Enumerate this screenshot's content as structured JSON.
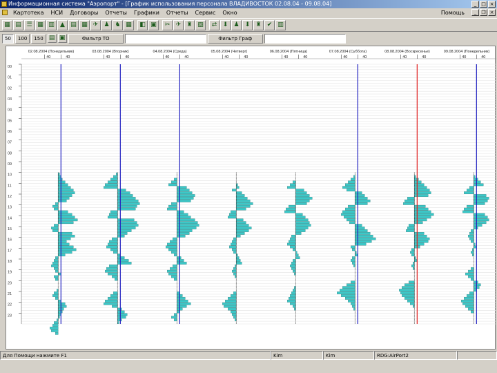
{
  "window": {
    "title": "Информационная система \"Аэропорт\" - [График использования персонала ВЛАДИВОСТОК 02.08.04 - 09.08.04]"
  },
  "menu": [
    "Картотека",
    "НСИ",
    "Договоры",
    "Отчеты",
    "Графики",
    "Отчеты",
    "Сервис",
    "Окно"
  ],
  "menu_right": "Помощь",
  "toolbar2": {
    "scale_buttons": [
      "50",
      "100",
      "150"
    ],
    "filter_to_label": "Фильтр ТО",
    "filter_graf_label": "Фильтр Граф"
  },
  "chart_data": {
    "type": "bar",
    "orientation": "horizontal-per-day",
    "days": [
      {
        "label": "02.08.2004 (Понедельник)",
        "ticks": [
          "40",
          "40"
        ],
        "line_color": "#2020c0",
        "values": [
          0,
          0,
          0,
          0,
          0,
          0,
          0,
          0,
          0,
          0,
          0,
          0,
          0,
          0,
          0,
          0,
          0,
          0,
          0,
          0,
          0,
          0,
          0,
          0,
          0,
          0,
          0,
          0,
          0,
          0,
          0,
          0,
          0,
          0,
          0,
          0,
          0,
          0,
          0,
          0,
          2,
          4,
          6,
          10,
          14,
          18,
          22,
          24,
          20,
          16,
          12,
          -4,
          -8,
          -6,
          14,
          20,
          24,
          28,
          22,
          -6,
          -10,
          -8,
          20,
          24,
          18,
          12,
          16,
          22,
          26,
          20,
          10,
          -4,
          -6,
          -8,
          -10,
          -6,
          -4,
          4,
          -6,
          -4,
          0,
          0,
          0,
          -2,
          -6,
          -8,
          -4,
          4,
          10,
          12,
          8,
          6,
          4,
          2,
          -2,
          -6,
          -8,
          -12,
          -10,
          -4
        ]
      },
      {
        "label": "03.08.2004 (Вторник)",
        "ticks": [
          "40",
          "40"
        ],
        "line_color": "#2020c0",
        "values": [
          0,
          0,
          0,
          0,
          0,
          0,
          0,
          0,
          0,
          0,
          0,
          0,
          0,
          0,
          0,
          0,
          0,
          0,
          0,
          0,
          0,
          0,
          0,
          0,
          0,
          0,
          0,
          0,
          0,
          0,
          0,
          0,
          0,
          0,
          0,
          0,
          0,
          0,
          0,
          0,
          -2,
          -6,
          -10,
          -14,
          -18,
          -20,
          12,
          18,
          22,
          26,
          30,
          32,
          28,
          26,
          -10,
          -12,
          -14,
          24,
          28,
          30,
          26,
          20,
          14,
          10,
          -8,
          -12,
          -14,
          -16,
          -10,
          -6,
          4,
          10,
          16,
          20,
          -12,
          -16,
          -18,
          -14,
          -8,
          -4,
          0,
          0,
          0,
          0,
          -6,
          -10,
          -14,
          -18,
          -20,
          -8,
          6,
          10,
          14,
          12,
          6,
          2,
          0,
          0,
          0,
          0
        ]
      },
      {
        "label": "04.08.2004 (Среда)",
        "ticks": [
          "40",
          "40"
        ],
        "line_color": "#2020c0",
        "values": [
          0,
          0,
          0,
          0,
          0,
          0,
          0,
          0,
          0,
          0,
          0,
          0,
          0,
          0,
          0,
          0,
          0,
          0,
          0,
          0,
          0,
          0,
          0,
          0,
          0,
          0,
          0,
          0,
          0,
          0,
          0,
          0,
          0,
          0,
          0,
          0,
          0,
          0,
          0,
          0,
          0,
          0,
          -4,
          -8,
          -12,
          14,
          18,
          22,
          26,
          24,
          20,
          -8,
          -12,
          -14,
          10,
          16,
          20,
          26,
          30,
          32,
          28,
          22,
          18,
          12,
          -6,
          -10,
          -14,
          -16,
          -12,
          -8,
          -4,
          6,
          10,
          14,
          -6,
          -10,
          -14,
          -12,
          -8,
          -4,
          0,
          0,
          0,
          0,
          4,
          8,
          12,
          16,
          20,
          14,
          8,
          4,
          -4,
          -8,
          -4,
          0,
          0,
          0,
          0,
          0
        ]
      },
      {
        "label": "05.08.2004 (Четверг)",
        "ticks": [
          "40",
          "40"
        ],
        "line_color": null,
        "values": [
          0,
          0,
          0,
          0,
          0,
          0,
          0,
          0,
          0,
          0,
          0,
          0,
          0,
          0,
          0,
          0,
          0,
          0,
          0,
          0,
          0,
          0,
          0,
          0,
          0,
          0,
          0,
          0,
          0,
          0,
          0,
          0,
          0,
          0,
          0,
          0,
          0,
          0,
          0,
          0,
          0,
          0,
          0,
          0,
          2,
          4,
          -6,
          8,
          12,
          16,
          20,
          24,
          20,
          14,
          -8,
          -10,
          -12,
          10,
          14,
          18,
          22,
          18,
          12,
          6,
          -4,
          -6,
          -8,
          -10,
          -6,
          -4,
          2,
          4,
          6,
          8,
          -2,
          -4,
          -6,
          -4,
          -2,
          0,
          0,
          0,
          0,
          0,
          -4,
          -8,
          -12,
          -16,
          -20,
          -18,
          -12,
          -8,
          -6,
          -4,
          -2,
          0,
          0,
          0,
          0,
          0
        ]
      },
      {
        "label": "06.08.2004 (Пятница)",
        "ticks": [
          "40",
          "40"
        ],
        "line_color": null,
        "values": [
          0,
          0,
          0,
          0,
          0,
          0,
          0,
          0,
          0,
          0,
          0,
          0,
          0,
          0,
          0,
          0,
          0,
          0,
          0,
          0,
          0,
          0,
          0,
          0,
          0,
          0,
          0,
          0,
          0,
          0,
          0,
          0,
          0,
          0,
          0,
          0,
          0,
          0,
          0,
          0,
          0,
          0,
          0,
          -4,
          -8,
          -12,
          12,
          16,
          20,
          24,
          20,
          16,
          -10,
          -14,
          -16,
          10,
          14,
          18,
          20,
          22,
          18,
          14,
          8,
          -6,
          -8,
          -10,
          -12,
          -8,
          -4,
          2,
          4,
          6,
          -4,
          -6,
          -8,
          -6,
          -4,
          -2,
          0,
          0,
          0,
          0,
          -2,
          -4,
          -6,
          -8,
          -10,
          -12,
          -8,
          -4,
          -2,
          0,
          0,
          0,
          0,
          0,
          0,
          0
        ]
      },
      {
        "label": "07.08.2004 (Суббота)",
        "ticks": [
          "40",
          "40"
        ],
        "line_color": "#2020c0",
        "values": [
          0,
          0,
          0,
          0,
          0,
          0,
          0,
          0,
          0,
          0,
          0,
          0,
          0,
          0,
          0,
          0,
          0,
          0,
          0,
          0,
          0,
          0,
          0,
          0,
          0,
          0,
          0,
          0,
          0,
          0,
          0,
          0,
          0,
          0,
          0,
          0,
          0,
          0,
          0,
          0,
          0,
          -2,
          -6,
          -10,
          -14,
          -18,
          -12,
          10,
          14,
          18,
          22,
          18,
          -10,
          -14,
          -18,
          -20,
          -16,
          -12,
          -8,
          10,
          14,
          18,
          22,
          26,
          30,
          24,
          16,
          -6,
          -4,
          2,
          4,
          -4,
          -6,
          -4,
          -2,
          0,
          0,
          0,
          0,
          0,
          -6,
          -12,
          -18,
          -22,
          -26,
          -20,
          -14,
          -10,
          -6,
          -4,
          -2,
          0,
          0,
          0,
          0,
          0,
          0,
          0,
          0,
          0
        ]
      },
      {
        "label": "08.08.2004 (Воскресенье)",
        "ticks": [
          "40",
          "40"
        ],
        "line_color": "#e02020",
        "values": [
          0,
          0,
          0,
          0,
          0,
          0,
          0,
          0,
          0,
          0,
          0,
          0,
          0,
          0,
          0,
          0,
          0,
          0,
          0,
          0,
          0,
          0,
          0,
          0,
          0,
          0,
          0,
          0,
          0,
          0,
          0,
          0,
          0,
          0,
          0,
          0,
          0,
          0,
          0,
          0,
          0,
          2,
          6,
          10,
          14,
          18,
          22,
          24,
          20,
          -10,
          -14,
          -16,
          16,
          20,
          24,
          28,
          24,
          18,
          12,
          -8,
          -10,
          -12,
          14,
          18,
          22,
          20,
          14,
          8,
          -4,
          -6,
          -4,
          2,
          4,
          -2,
          -4,
          -2,
          0,
          0,
          0,
          0,
          -8,
          -14,
          -18,
          -22,
          -20,
          -18,
          -14,
          -10,
          -6,
          -2,
          0,
          0,
          0,
          0,
          0,
          0,
          0,
          0,
          0,
          0
        ]
      },
      {
        "label": "09.08.2004 (Понедельник)",
        "ticks": [
          "40",
          "40"
        ],
        "line_color": "#2020c0",
        "values": [
          0,
          0,
          0,
          0,
          0,
          0,
          0,
          0,
          0,
          0,
          0,
          0,
          0,
          0,
          0,
          0,
          0,
          0,
          0,
          0,
          0,
          0,
          0,
          0,
          0,
          0,
          0,
          0,
          0,
          0,
          0,
          0,
          0,
          0,
          0,
          0,
          0,
          0,
          0,
          0,
          0,
          2,
          6,
          10,
          14,
          -6,
          -10,
          -14,
          18,
          22,
          20,
          16,
          -10,
          -14,
          -16,
          16,
          20,
          22,
          18,
          12,
          6,
          -4,
          -6,
          -8,
          -6,
          -4,
          2,
          4,
          -2,
          -4,
          -2,
          0,
          0,
          0,
          0,
          -4,
          -8,
          -12,
          -8,
          -4,
          6,
          10,
          8,
          4,
          -6,
          -10,
          -14,
          -18,
          -16,
          -12,
          -8,
          -4,
          0,
          0,
          0,
          0,
          0,
          0,
          0,
          0
        ]
      }
    ],
    "hours": [
      "00",
      "01",
      "02",
      "03",
      "04",
      "05",
      "06",
      "07",
      "08",
      "09",
      "10",
      "11",
      "12",
      "13",
      "14",
      "15",
      "16",
      "17",
      "18",
      "19",
      "20",
      "21",
      "22",
      "23"
    ],
    "grid": true
  },
  "status": {
    "hint": "Для Помощи нажмите F1",
    "user1": "Kim",
    "user2": "Kim",
    "db": "RDG:AirPort2"
  }
}
